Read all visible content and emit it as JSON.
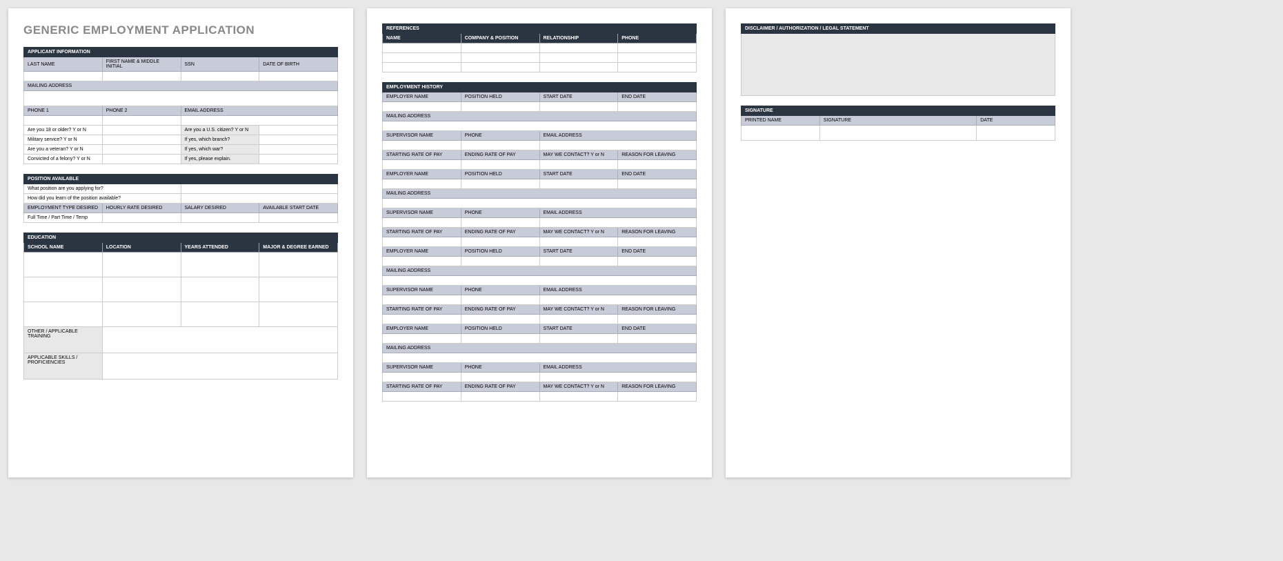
{
  "title": "GENERIC EMPLOYMENT APPLICATION",
  "applicant": {
    "section": "APPLICANT INFORMATION",
    "last_name": "LAST NAME",
    "first_name": "FIRST NAME & MIDDLE INITIAL",
    "ssn": "SSN",
    "dob": "DATE OF BIRTH",
    "mailing": "MAILING ADDRESS",
    "phone1": "PHONE 1",
    "phone2": "PHONE 2",
    "email": "EMAIL ADDRESS",
    "q18": "Are you 18 or older?  Y or N",
    "qcitizen": "Are you a U.S. citizen?  Y or N",
    "qmilitary": "Military service?  Y or N",
    "qbranch": "If yes, which branch?",
    "qveteran": "Are you a veteran?  Y or N",
    "qwar": "If yes, which war?",
    "qfelony": "Convicted of a felony?  Y or N",
    "qexplain": "If yes, please explain."
  },
  "position": {
    "section": "POSITION AVAILABLE",
    "q_position": "What position are you applying for?",
    "q_learn": "How did you learn of the position available?",
    "emp_type": "EMPLOYMENT TYPE DESIRED",
    "hourly": "HOURLY RATE DESIRED",
    "salary": "SALARY DESIRED",
    "start": "AVAILABLE START DATE",
    "ftpt": "Full Time / Part Time / Temp"
  },
  "education": {
    "section": "EDUCATION",
    "school": "SCHOOL NAME",
    "location": "LOCATION",
    "years": "YEARS ATTENDED",
    "major": "MAJOR & DEGREE EARNED",
    "other": "OTHER / APPLICABLE TRAINING",
    "skills": "APPLICABLE SKILLS / PROFICIENCIES"
  },
  "references": {
    "section": "REFERENCES",
    "name": "NAME",
    "company": "COMPANY & POSITION",
    "relationship": "RELATIONSHIP",
    "phone": "PHONE"
  },
  "employment": {
    "section": "EMPLOYMENT HISTORY",
    "employer": "EMPLOYER NAME",
    "position": "POSITION HELD",
    "start": "START DATE",
    "end": "END DATE",
    "mailing": "MAILING ADDRESS",
    "supervisor": "SUPERVISOR NAME",
    "phone": "PHONE",
    "email": "EMAIL ADDRESS",
    "startpay": "STARTING RATE OF PAY",
    "endpay": "ENDING RATE OF PAY",
    "contact": "MAY WE CONTACT? Y or N",
    "reason": "REASON FOR LEAVING"
  },
  "disclaimer": {
    "section": "DISCLAIMER / AUTHORIZATION / LEGAL STATEMENT"
  },
  "signature": {
    "section": "SIGNATURE",
    "printed": "PRINTED NAME",
    "sig": "SIGNATURE",
    "date": "DATE"
  }
}
